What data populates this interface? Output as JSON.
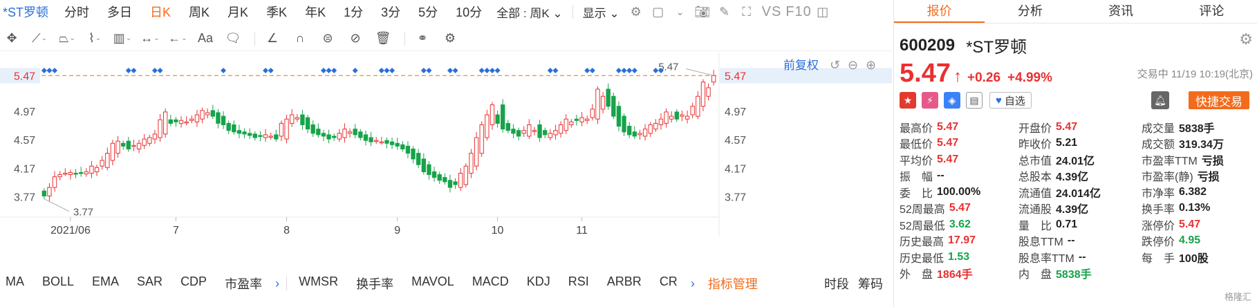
{
  "toolbar": {
    "stock_name": "*ST罗顿",
    "periods": [
      "分时",
      "多日",
      "日K",
      "周K",
      "月K",
      "季K",
      "年K",
      "1分",
      "3分",
      "5分",
      "10分"
    ],
    "active_period": "日K",
    "all_select": "全部 : 周K",
    "display_label": "显示",
    "vs_label": "VS",
    "f10_label": "F10"
  },
  "drawing_tools": {
    "text_tool_label": "Aa"
  },
  "chart": {
    "fuquan_label": "前复权",
    "current_price_label": "5.47",
    "price_marker": "5.47",
    "low_marker": "3.77",
    "y_ticks": [
      "4.97",
      "4.57",
      "4.17",
      "3.77"
    ],
    "y_tick_values": [
      4.97,
      4.57,
      4.17,
      3.77
    ],
    "x_labels": [
      {
        "label": "2021/06",
        "index": 5
      },
      {
        "label": "7",
        "index": 25
      },
      {
        "label": "8",
        "index": 46
      },
      {
        "label": "9",
        "index": 67
      },
      {
        "label": "10",
        "index": 86
      },
      {
        "label": "11",
        "index": 102
      }
    ],
    "colors": {
      "up": "#e93030",
      "down": "#16a34a",
      "ref_line": "#f28a3b",
      "marker": "#2a6fd8",
      "grid": "#e8e8e8"
    }
  },
  "chart_data": {
    "type": "candlestick",
    "title": "",
    "ylim": [
      3.6,
      5.6
    ],
    "current_price": 5.47,
    "open": [
      3.85,
      3.78,
      3.9,
      4.05,
      4.1,
      4.08,
      4.1,
      4.11,
      4.09,
      4.1,
      4.12,
      4.2,
      4.18,
      4.28,
      4.38,
      4.52,
      4.55,
      4.48,
      4.44,
      4.49,
      4.52,
      4.58,
      4.6,
      4.65,
      4.85,
      4.85,
      4.8,
      4.82,
      4.84,
      4.82,
      4.86,
      4.92,
      4.98,
      4.95,
      4.9,
      4.8,
      4.78,
      4.7,
      4.68,
      4.66,
      4.65,
      4.63,
      4.6,
      4.62,
      4.64,
      4.62,
      4.58,
      4.8,
      4.86,
      4.92,
      4.88,
      4.78,
      4.72,
      4.66,
      4.64,
      4.62,
      4.58,
      4.6,
      4.66,
      4.72,
      4.68,
      4.64,
      4.6,
      4.56,
      4.54,
      4.56,
      4.54,
      4.52,
      4.5,
      4.48,
      4.44,
      4.38,
      4.3,
      4.22,
      4.12,
      4.08,
      4.04,
      4.0,
      3.98,
      3.9,
      3.94,
      4.1,
      4.2,
      4.38,
      4.6,
      4.78,
      4.92,
      5.06,
      4.8,
      4.72,
      4.7,
      4.66,
      4.62,
      4.7,
      4.78,
      4.7,
      4.6,
      4.64,
      4.66,
      4.7,
      4.78,
      4.86,
      4.82,
      4.84,
      4.88,
      4.86,
      5.0,
      5.28,
      5.18,
      5.04,
      4.9,
      4.76,
      4.68,
      4.64,
      4.62,
      4.66,
      4.72,
      4.78,
      4.8,
      4.86,
      4.96,
      4.9,
      4.86,
      4.92,
      4.9,
      5.04,
      5.18,
      5.38
    ],
    "close": [
      3.78,
      3.9,
      4.05,
      4.08,
      4.1,
      4.11,
      4.09,
      4.1,
      4.12,
      4.2,
      4.18,
      4.28,
      4.38,
      4.52,
      4.55,
      4.48,
      4.44,
      4.49,
      4.52,
      4.58,
      4.6,
      4.65,
      4.85,
      4.96,
      4.8,
      4.82,
      4.84,
      4.82,
      4.86,
      4.92,
      4.98,
      4.95,
      4.9,
      4.8,
      4.78,
      4.7,
      4.68,
      4.66,
      4.65,
      4.63,
      4.6,
      4.62,
      4.64,
      4.62,
      4.58,
      4.8,
      4.86,
      4.92,
      4.88,
      4.78,
      4.72,
      4.66,
      4.64,
      4.62,
      4.58,
      4.6,
      4.66,
      4.72,
      4.68,
      4.64,
      4.6,
      4.56,
      4.54,
      4.56,
      4.54,
      4.52,
      4.5,
      4.48,
      4.44,
      4.38,
      4.3,
      4.22,
      4.12,
      4.08,
      4.04,
      4.0,
      3.98,
      3.9,
      3.94,
      4.1,
      4.2,
      4.38,
      4.6,
      4.78,
      4.92,
      5.06,
      4.8,
      4.72,
      4.7,
      4.66,
      4.62,
      4.7,
      4.78,
      4.7,
      4.6,
      4.64,
      4.66,
      4.7,
      4.78,
      4.86,
      4.82,
      4.84,
      4.88,
      4.86,
      5.0,
      5.28,
      5.18,
      5.04,
      4.9,
      4.76,
      4.68,
      4.64,
      4.62,
      4.66,
      4.72,
      4.78,
      4.8,
      4.86,
      4.96,
      4.9,
      4.86,
      4.92,
      4.9,
      5.04,
      5.18,
      5.38,
      5.3,
      5.47
    ]
  },
  "right": {
    "tabs": [
      "报价",
      "分析",
      "资讯",
      "评论"
    ],
    "active_tab": "报价",
    "code": "600209",
    "name": "*ST罗顿",
    "price": "5.47",
    "change": "+0.26",
    "change_pct": "+4.99%",
    "trade_time": "交易中 11/19 10:19(北京)",
    "fav_label": "自选",
    "quick_trade_label": "快捷交易",
    "stats": [
      [
        {
          "label": "最高价",
          "value": "5.47",
          "color": "red"
        },
        {
          "label": "开盘价",
          "value": "5.47",
          "color": "red"
        },
        {
          "label": "成交量",
          "value": "5838手",
          "color": ""
        }
      ],
      [
        {
          "label": "最低价",
          "value": "5.47",
          "color": "red"
        },
        {
          "label": "昨收价",
          "value": "5.21",
          "color": ""
        },
        {
          "label": "成交额",
          "value": "319.34万",
          "color": ""
        }
      ],
      [
        {
          "label": "平均价",
          "value": "5.47",
          "color": "red"
        },
        {
          "label": "总市值",
          "value": "24.01亿",
          "color": ""
        },
        {
          "label": "市盈率TTM",
          "value": "亏损",
          "color": ""
        }
      ],
      [
        {
          "label": "振　幅",
          "value": "--",
          "color": ""
        },
        {
          "label": "总股本",
          "value": "4.39亿",
          "color": ""
        },
        {
          "label": "市盈率(静)",
          "value": "亏损",
          "color": ""
        }
      ],
      [
        {
          "label": "委　比",
          "value": "100.00%",
          "color": ""
        },
        {
          "label": "流通值",
          "value": "24.014亿",
          "color": ""
        },
        {
          "label": "市净率",
          "value": "6.382",
          "color": ""
        }
      ],
      [
        {
          "label": "52周最高",
          "value": "5.47",
          "color": "red"
        },
        {
          "label": "流通股",
          "value": "4.39亿",
          "color": ""
        },
        {
          "label": "换手率",
          "value": "0.13%",
          "color": ""
        }
      ],
      [
        {
          "label": "52周最低",
          "value": "3.62",
          "color": "green"
        },
        {
          "label": "量　比",
          "value": "0.71",
          "color": ""
        },
        {
          "label": "涨停价",
          "value": "5.47",
          "color": "red"
        }
      ],
      [
        {
          "label": "历史最高",
          "value": "17.97",
          "color": "red"
        },
        {
          "label": "股息TTM",
          "value": "--",
          "color": ""
        },
        {
          "label": "跌停价",
          "value": "4.95",
          "color": "green"
        }
      ],
      [
        {
          "label": "历史最低",
          "value": "1.53",
          "color": "green"
        },
        {
          "label": "股息率TTM",
          "value": "--",
          "color": ""
        },
        {
          "label": "每　手",
          "value": "100股",
          "color": ""
        }
      ],
      [
        {
          "label": "外　盘",
          "value": "1864手",
          "color": "red"
        },
        {
          "label": "内　盘",
          "value": "5838手",
          "color": "green"
        },
        {
          "label": "",
          "value": "",
          "color": ""
        }
      ]
    ],
    "watermark": "格隆汇"
  },
  "indicators": {
    "items": [
      "MA",
      "BOLL",
      "EMA",
      "SAR",
      "CDP",
      "市盈率"
    ],
    "items2": [
      "WMSR",
      "换手率",
      "MAVOL",
      "MACD",
      "KDJ",
      "RSI",
      "ARBR",
      "CR"
    ],
    "manage_label": "指标管理",
    "extra": [
      "时段",
      "筹码"
    ]
  }
}
